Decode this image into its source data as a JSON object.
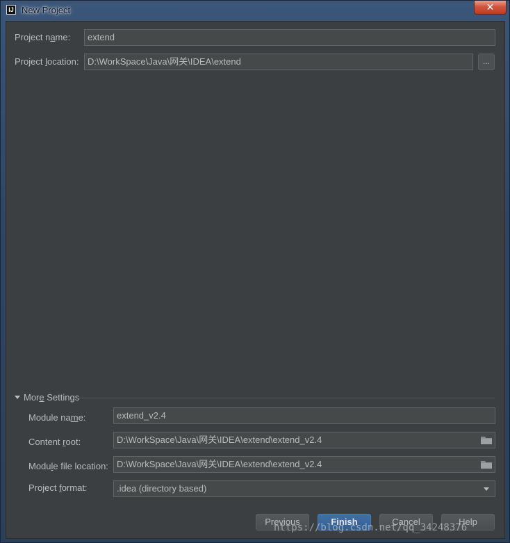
{
  "window": {
    "title": "New Project",
    "close_glyph": "✕"
  },
  "fields": {
    "project_name": {
      "label_pre": "Project n",
      "label_u": "a",
      "label_post": "me:",
      "value": "extend"
    },
    "project_location": {
      "label_pre": "Project ",
      "label_u": "l",
      "label_post": "ocation:",
      "value": "D:\\WorkSpace\\Java\\网关\\IDEA\\extend",
      "browse_label": "..."
    }
  },
  "more_settings": {
    "toggle_pre": "Mor",
    "toggle_u": "e",
    "toggle_post": " Settings",
    "module_name": {
      "label_pre": "Module na",
      "label_u": "m",
      "label_post": "e:",
      "value": "extend_v2.4"
    },
    "content_root": {
      "label_pre": "Content ",
      "label_u": "r",
      "label_post": "oot:",
      "value": "D:\\WorkSpace\\Java\\网关\\IDEA\\extend\\extend_v2.4"
    },
    "module_file_location": {
      "label_pre": "Modu",
      "label_u": "l",
      "label_post": "e file location:",
      "value": "D:\\WorkSpace\\Java\\网关\\IDEA\\extend\\extend_v2.4"
    },
    "project_format": {
      "label_pre": "Project ",
      "label_u": "f",
      "label_post": "ormat:",
      "selected": ".idea (directory based)"
    }
  },
  "buttons": {
    "previous": "Previous",
    "finish": "Finish",
    "cancel": "Cancel",
    "help": "Help"
  },
  "watermark": "https://blog.csdn.net/qq_34248376",
  "colors": {
    "dialog_bg": "#3c3f41",
    "field_bg": "#45494a",
    "primary": "#365f92",
    "text": "#bbbbbb"
  },
  "icons": {
    "app": "intellij-icon",
    "folder": "folder-icon",
    "dropdown": "chevron-down-icon"
  }
}
